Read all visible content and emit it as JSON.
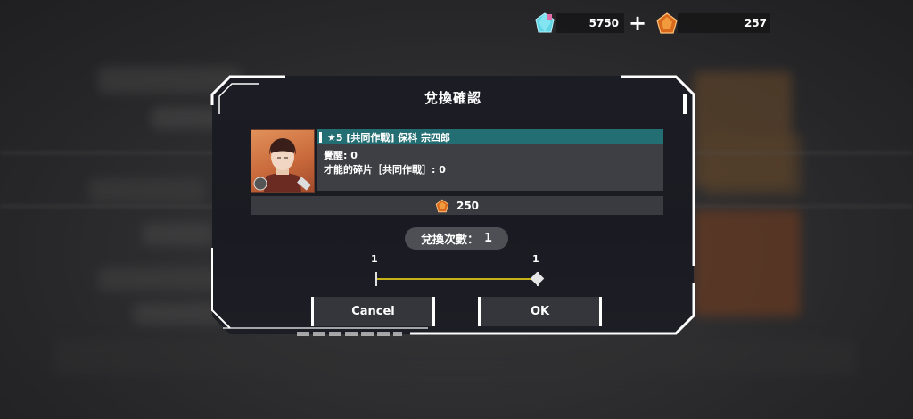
{
  "currencies": [
    {
      "icon": "crystal-gem-icon",
      "value": "5750"
    },
    {
      "icon": "orange-gem-icon",
      "value": "257"
    }
  ],
  "dialog": {
    "title": "兌換確認",
    "character": {
      "name_line": "★5 [共同作戰] 保科 宗四郎",
      "awakening": "覺醒: 0",
      "shards": "才能的碎片［共同作戰］: 0"
    },
    "cost": {
      "icon": "orange-gem-icon",
      "value": "250"
    },
    "count_label": "兌換次數：",
    "count_value": "1",
    "slider": {
      "min_label": "1",
      "max_label": "1",
      "value": 1,
      "min": 1,
      "max": 1
    },
    "cancel_label": "Cancel",
    "ok_label": "OK"
  },
  "colors": {
    "accent_teal": "#236e73",
    "slider_yellow": "#c7b21a",
    "dialog_bg": "#1c1d24"
  }
}
